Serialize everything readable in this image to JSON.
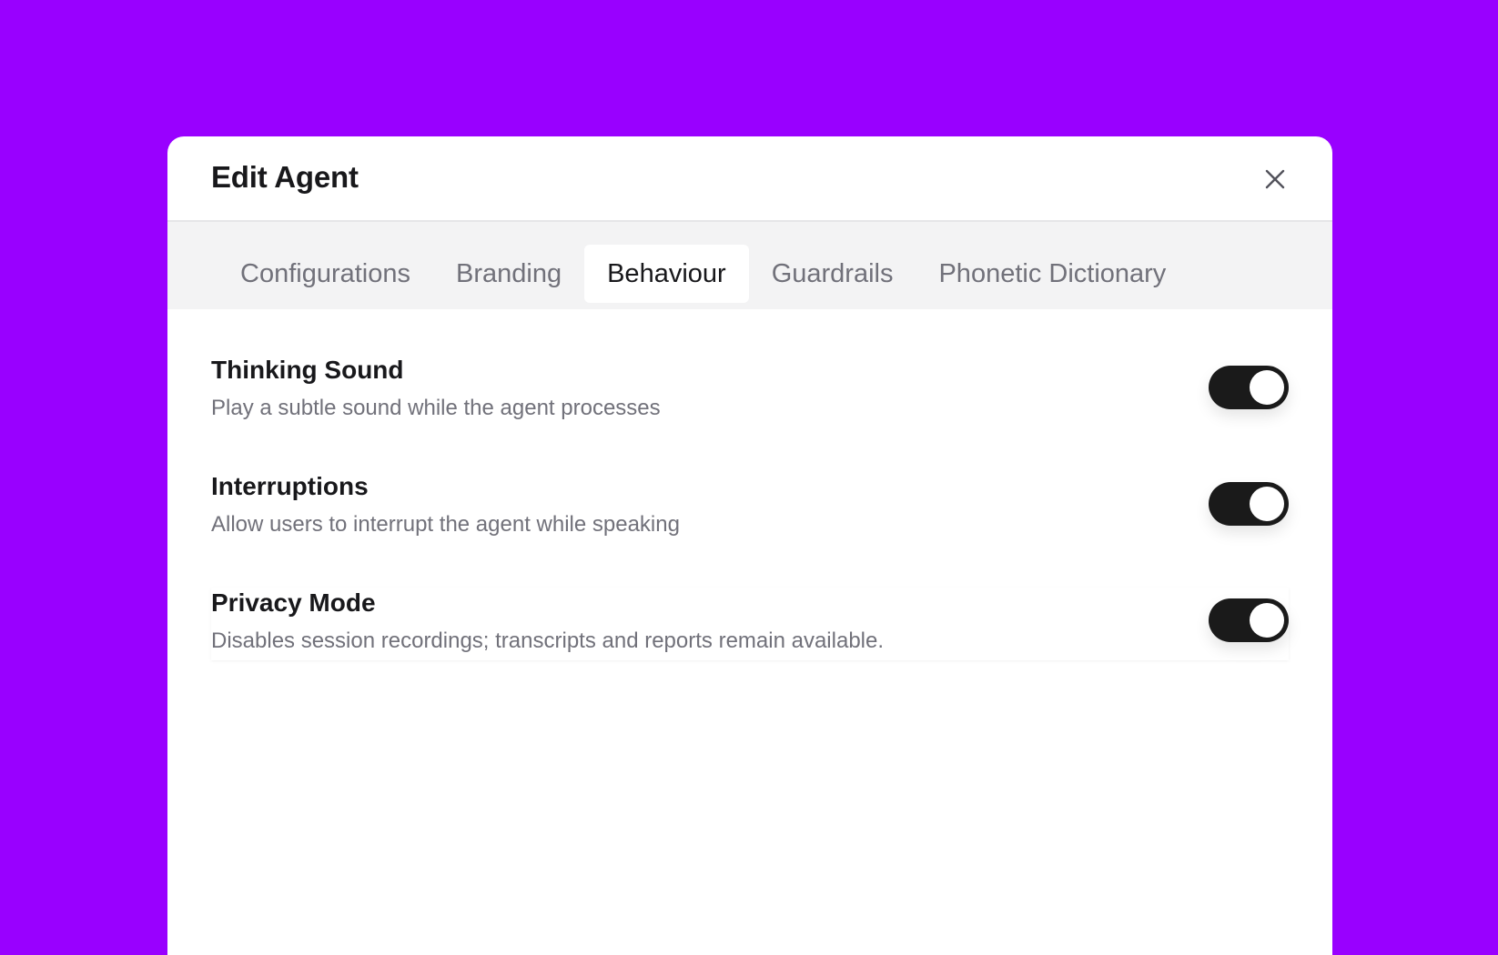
{
  "modal": {
    "title": "Edit Agent",
    "close_icon": "close-icon"
  },
  "tabs": [
    {
      "label": "Configurations",
      "active": false
    },
    {
      "label": "Branding",
      "active": false
    },
    {
      "label": "Behaviour",
      "active": true
    },
    {
      "label": "Guardrails",
      "active": false
    },
    {
      "label": "Phonetic Dictionary",
      "active": false
    }
  ],
  "settings": [
    {
      "title": "Thinking Sound",
      "description": "Play a subtle sound while the agent processes",
      "enabled": true
    },
    {
      "title": "Interruptions",
      "description": "Allow users to interrupt the agent while speaking",
      "enabled": true
    },
    {
      "title": "Privacy Mode",
      "description": "Disables session recordings; transcripts and reports remain available.",
      "enabled": true
    }
  ],
  "colors": {
    "background": "#9900ff",
    "toggle_on": "#1a1a1a",
    "tabbar": "#f3f3f4"
  }
}
